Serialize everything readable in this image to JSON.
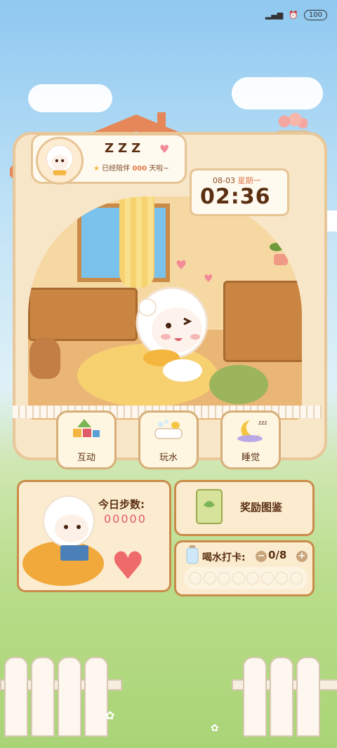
{
  "status_bar": {
    "battery": "100"
  },
  "profile": {
    "name": "ZZZ",
    "companion_prefix": "已经陪伴",
    "companion_days": "000",
    "companion_suffix": "天啦~"
  },
  "clock": {
    "date": "08-03",
    "weekday": "星期一",
    "time": "02:36"
  },
  "actions": [
    {
      "label": "互动",
      "icon": "toy-blocks-icon"
    },
    {
      "label": "玩水",
      "icon": "bathtub-icon"
    },
    {
      "label": "睡觉",
      "icon": "moon-sleep-icon"
    }
  ],
  "steps": {
    "title": "今日步数:",
    "value": "00000"
  },
  "rewards": {
    "label": "奖励图鉴"
  },
  "water": {
    "label": "喝水打卡:",
    "progress": "0/8",
    "minus": "−",
    "plus": "+"
  },
  "colors": {
    "accent": "#e07a4a",
    "brown": "#5a2f12",
    "panel": "#fbecd0"
  }
}
